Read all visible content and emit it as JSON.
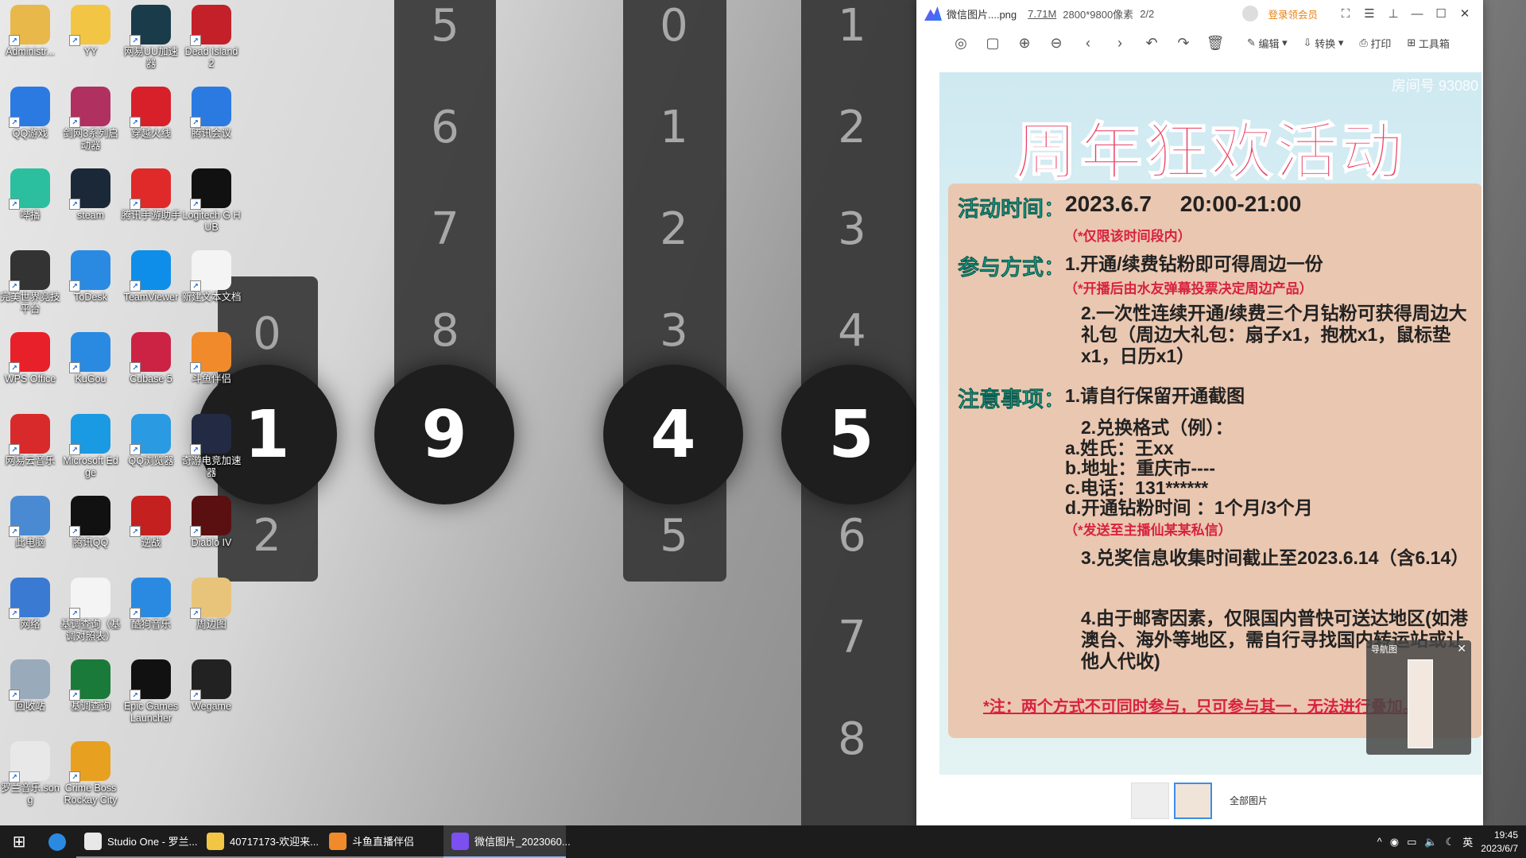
{
  "desktop": {
    "icons": [
      {
        "label": "Administr...",
        "icon": "user-folder-icon",
        "color": "#e8b84a"
      },
      {
        "label": "YY",
        "icon": "yy-icon",
        "color": "#f2c544"
      },
      {
        "label": "网易UU加速器",
        "icon": "uu-icon",
        "color": "#1a3b4a"
      },
      {
        "label": "Dead Island 2",
        "icon": "dead-island-icon",
        "color": "#c4202a"
      },
      {
        "label": "QQ游戏",
        "icon": "qq-game-icon",
        "color": "#2a7ae2"
      },
      {
        "label": "剑网3系列启动器",
        "icon": "jx3-icon",
        "color": "#b03060"
      },
      {
        "label": "穿越火线",
        "icon": "crossfire-icon",
        "color": "#d8202a"
      },
      {
        "label": "腾讯会议",
        "icon": "tencent-meeting-icon",
        "color": "#2a7ae2"
      },
      {
        "label": "哔播",
        "icon": "bibo-icon",
        "color": "#2bbfa0"
      },
      {
        "label": "steam",
        "icon": "steam-icon",
        "color": "#1b2838"
      },
      {
        "label": "腾讯手游助手",
        "icon": "tencent-mobile-icon",
        "color": "#e02a2a"
      },
      {
        "label": "Logitech G HUB",
        "icon": "logitech-icon",
        "color": "#111111"
      },
      {
        "label": "完美世界竞技平台",
        "icon": "perfect-world-icon",
        "color": "#333333"
      },
      {
        "label": "ToDesk",
        "icon": "todesk-icon",
        "color": "#2a8ae2"
      },
      {
        "label": "TeamViewer",
        "icon": "teamviewer-icon",
        "color": "#0e8ee9"
      },
      {
        "label": "新建文本文档",
        "icon": "text-file-icon",
        "color": "#f4f4f4"
      },
      {
        "label": "WPS Office",
        "icon": "wps-icon",
        "color": "#e8202a"
      },
      {
        "label": "KuGou",
        "icon": "kugou-icon",
        "color": "#2a8ae2"
      },
      {
        "label": "Cubase 5",
        "icon": "cubase-icon",
        "color": "#cc2244"
      },
      {
        "label": "斗鱼伴侣",
        "icon": "douyu-icon",
        "color": "#f08a2a"
      },
      {
        "label": "网易云音乐",
        "icon": "netease-music-icon",
        "color": "#d82a2a"
      },
      {
        "label": "Microsoft Edge",
        "icon": "edge-icon",
        "color": "#1a9ae2"
      },
      {
        "label": "QQ浏览器",
        "icon": "qq-browser-icon",
        "color": "#2a9ae2"
      },
      {
        "label": "奇游电竞加速器",
        "icon": "qiyou-icon",
        "color": "#222a44"
      },
      {
        "label": "此电脑",
        "icon": "this-pc-icon",
        "color": "#4a8ad2"
      },
      {
        "label": "腾讯QQ",
        "icon": "qq-icon",
        "color": "#111111"
      },
      {
        "label": "逆战",
        "icon": "nizhan-icon",
        "color": "#c42020"
      },
      {
        "label": "Diablo IV",
        "icon": "diablo-icon",
        "color": "#5a1010"
      },
      {
        "label": "网络",
        "icon": "network-icon",
        "color": "#3a7ad2"
      },
      {
        "label": "基调查询（基调对照表）",
        "icon": "doc-file-icon",
        "color": "#f4f4f4"
      },
      {
        "label": "酷狗音乐",
        "icon": "kugou-music-icon",
        "color": "#2a8ae2"
      },
      {
        "label": "周边图",
        "icon": "folder-icon",
        "color": "#e8c47a"
      },
      {
        "label": "回收站",
        "icon": "recycle-bin-icon",
        "color": "#9ab"
      },
      {
        "label": "基调查询",
        "icon": "music-key-icon",
        "color": "#1a7a3a"
      },
      {
        "label": "Epic Games Launcher",
        "icon": "epic-icon",
        "color": "#111111"
      },
      {
        "label": "Wegame",
        "icon": "wegame-icon",
        "color": "#222222"
      },
      {
        "label": "罗兰音乐.song",
        "icon": "studio-one-icon",
        "color": "#e8e8e8"
      },
      {
        "label": "Crime Boss Rockay City",
        "icon": "crime-boss-icon",
        "color": "#e8a020"
      }
    ]
  },
  "clock_wallpaper": {
    "col1": {
      "above": "0",
      "center": "1",
      "below": "2"
    },
    "col2": {
      "above": [
        "5",
        "6",
        "7",
        "8"
      ],
      "center": "9"
    },
    "col3": {
      "above": [
        "0",
        "1",
        "2",
        "3"
      ],
      "center": "4",
      "below": "5"
    },
    "col4": {
      "above": [
        "1",
        "2",
        "3",
        "4"
      ],
      "center": "5",
      "below": [
        "6",
        "7",
        "8"
      ]
    }
  },
  "viewer": {
    "title": "微信图片....png",
    "size": "7.71M",
    "dims": "2800*9800像素",
    "index": "2/2",
    "vip": "登录领会员",
    "toolbar": {
      "edit": "编辑",
      "convert": "转换",
      "print": "打印",
      "tools": "工具箱"
    },
    "all_images": "全部图片",
    "minimap_title": "导航图"
  },
  "poster": {
    "title": "周年狂欢活动",
    "watermark": "房间号 93080",
    "sec_time": "活动时间：",
    "time_value": "2023.6.7　 20:00-21:00",
    "time_note": "（*仅限该时间段内）",
    "sec_method": "参与方式：",
    "method1": "1.开通/续费钻粉即可得周边一份",
    "method1_note": "（*开播后由水友弹幕投票决定周边产品）",
    "method2": "2.一次性连续开通/续费三个月钻粉可获得周边大礼包（周边大礼包：扇子x1，抱枕x1，鼠标垫x1，日历x1）",
    "sec_notice": "注意事项：",
    "notice1": "1.请自行保留开通截图",
    "notice2": "2.兑换格式（例）：",
    "notice2a": "a.姓氏：王xx",
    "notice2b": "b.地址：重庆市----",
    "notice2c": "c.电话：131******",
    "notice2d": "d.开通钻粉时间 ：1个月/3个月",
    "notice2_note": "（*发送至主播仙某某私信）",
    "notice3": "3.兑奖信息收集时间截止至2023.6.14（含6.14）",
    "notice4": "4.由于邮寄因素，仅限国内普快可送达地区(如港澳台、海外等地区，需自行寻找国内转运站或让他人代收)",
    "footer_note": "*注：两个方式不可同时参与，只可参与其一，无法进行叠加。"
  },
  "taskbar": {
    "apps": [
      {
        "label": "Studio One - 罗兰...",
        "icon": "studio-one-icon",
        "color": "#e8e8e8"
      },
      {
        "label": "40717173-欢迎来...",
        "icon": "yy-icon",
        "color": "#f2c544"
      },
      {
        "label": "斗鱼直播伴侣",
        "icon": "douyu-icon",
        "color": "#f08a2a"
      },
      {
        "label": "微信图片_2023060...",
        "icon": "image-viewer-icon",
        "color": "#7b4ff0"
      }
    ],
    "ime": "英",
    "time": "19:45",
    "date": "2023/6/7"
  }
}
